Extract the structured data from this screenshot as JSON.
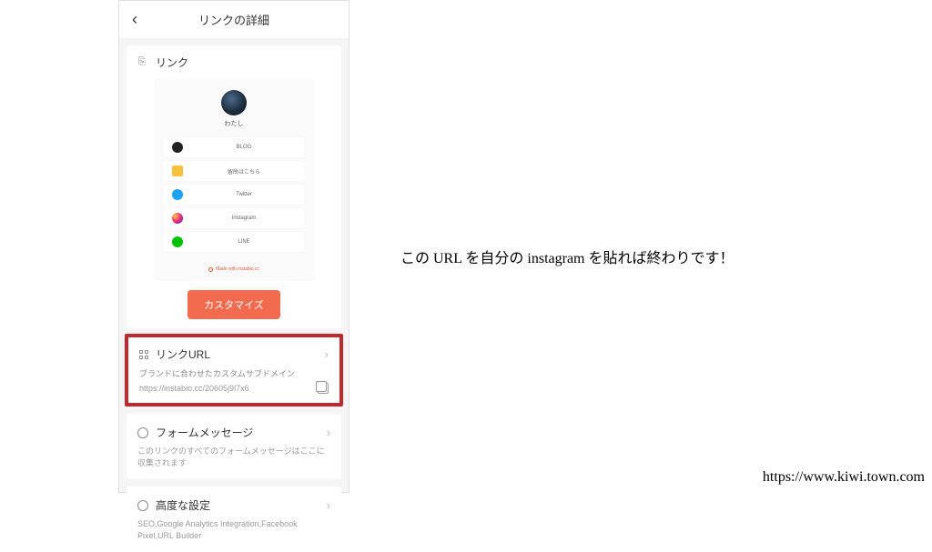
{
  "header": {
    "title": "リンクの詳細"
  },
  "link_section": {
    "title": "リンク",
    "profile_name": "わたし",
    "items": [
      {
        "label": "BLOG"
      },
      {
        "label": "留所はこちら"
      },
      {
        "label": "Twitter"
      },
      {
        "label": "Instagram"
      },
      {
        "label": "LINE"
      }
    ],
    "made_with": "Made with instabio.cc",
    "customize_button": "カスタマイズ"
  },
  "url_section": {
    "title": "リンクURL",
    "subtitle": "ブランドに合わせたカスタムサブドメイン",
    "url": "https://instabio.cc/20605j9l7x6"
  },
  "form_section": {
    "title": "フォームメッセージ",
    "subtitle": "このリンクのすべてのフォームメッセージはここに収集されます"
  },
  "advanced_section": {
    "title": "高度な設定",
    "subtitle": "SEO,Google Analytics Integration,Facebook Pixel,URL Builder"
  },
  "annotation": "この URL を自分の instagram を貼れば終わりです！",
  "source_url": "https://www.kiwi.town.com"
}
